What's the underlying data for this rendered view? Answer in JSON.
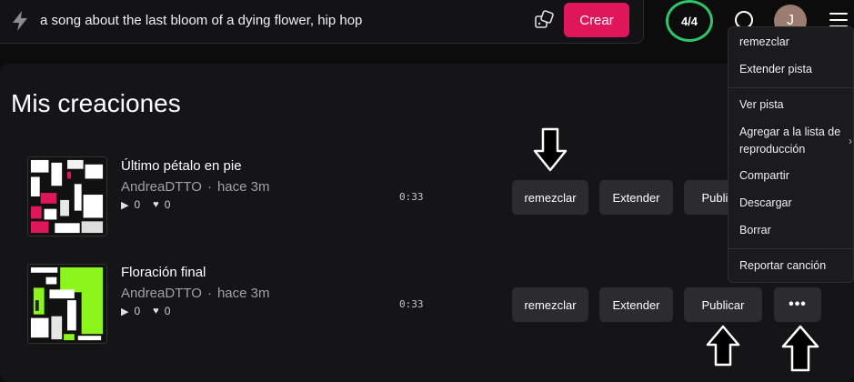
{
  "prompt": {
    "text": "a song about the last bloom of a dying flower, hip hop",
    "create_label": "Crear"
  },
  "header": {
    "credits": "4/4",
    "avatar_initial": "J"
  },
  "section_title": "Mis creaciones",
  "songs": [
    {
      "title": "Último pétalo en pie",
      "author": "AndreaDTTO",
      "separator": "·",
      "time_ago": "hace 3m",
      "plays": "0",
      "likes": "0",
      "duration": "0:33",
      "buttons": {
        "remix": "remezclar",
        "extend": "Extender",
        "publish": "Publicar"
      }
    },
    {
      "title": "Floración final",
      "author": "AndreaDTTO",
      "separator": "·",
      "time_ago": "hace 3m",
      "plays": "0",
      "likes": "0",
      "duration": "0:33",
      "buttons": {
        "remix": "remezclar",
        "extend": "Extender",
        "publish": "Publicar",
        "more": "•••"
      }
    }
  ],
  "context_menu": {
    "items": [
      "remezclar",
      "Extender pista",
      "Ver pista",
      "Agregar a la lista de reproducción",
      "Compartir",
      "Descargar",
      "Borrar",
      "Reportar canción"
    ]
  },
  "colors": {
    "accent": "#e0165a",
    "credits_ring": "#2fc46a",
    "cover1_accent": "#e0165a",
    "cover2_accent": "#8cf51c"
  }
}
